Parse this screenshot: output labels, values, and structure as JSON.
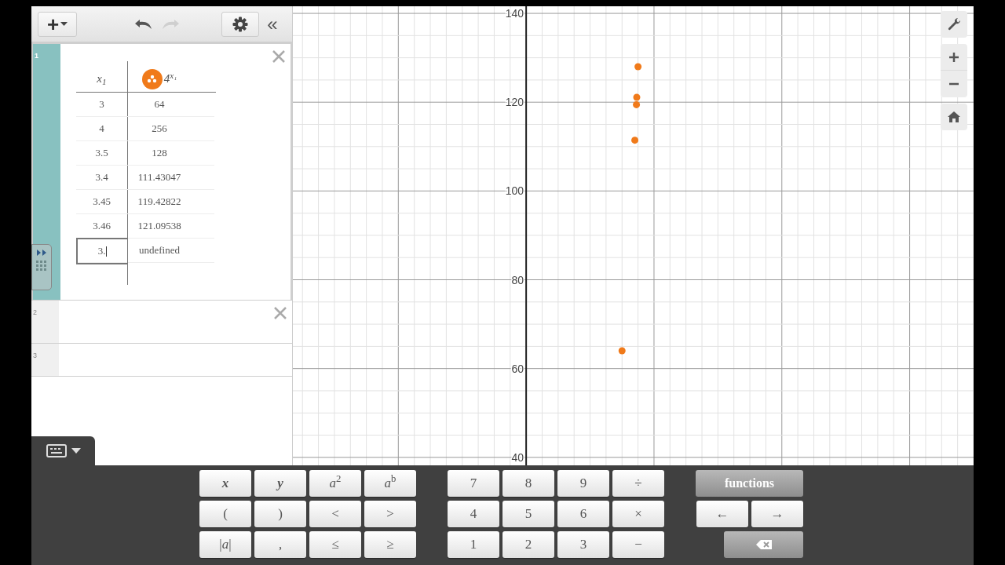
{
  "toolbar": {
    "add_label": "+",
    "undo": {
      "disabled": false
    },
    "redo": {
      "disabled": true
    },
    "collapse_label": "«"
  },
  "expressions": [
    {
      "index": "1",
      "selected": true,
      "close_button": true,
      "kind": "table",
      "table": {
        "columns": [
          {
            "label": "x$_{1}$",
            "color_icon": false
          },
          {
            "label": "4$^{x₁}$",
            "color_icon": true,
            "color": "#f07a1a"
          }
        ],
        "rows": [
          {
            "cells": [
              "3",
              "64"
            ],
            "focused": false
          },
          {
            "cells": [
              "4",
              "256"
            ],
            "focused": false
          },
          {
            "cells": [
              "3.5",
              "128"
            ],
            "focused": false
          },
          {
            "cells": [
              "3.4",
              "111.43047"
            ],
            "focused": false
          },
          {
            "cells": [
              "3.45",
              "119.42822"
            ],
            "focused": false
          },
          {
            "cells": [
              "3.46",
              "121.09538"
            ],
            "focused": false
          },
          {
            "cells": [
              "3.",
              "undefined"
            ],
            "focused": true
          }
        ]
      }
    },
    {
      "index": "2",
      "selected": false,
      "close_button": true,
      "kind": "empty"
    },
    {
      "index": "3",
      "selected": false,
      "close_button": false,
      "kind": "empty"
    }
  ],
  "graph": {
    "y_axis_labels": [
      "140",
      "120",
      "100",
      "80",
      "60",
      "40"
    ]
  },
  "keypad": {
    "groups": [
      {
        "rows": [
          [
            {
              "label": "*x*",
              "kind": "var"
            },
            {
              "label": "*y*",
              "kind": "var"
            },
            {
              "label": "*a*$^{2}$",
              "kind": "key"
            },
            {
              "label": "*a*$^{b}$",
              "kind": "key"
            }
          ],
          [
            {
              "label": "(",
              "kind": "key"
            },
            {
              "label": ")",
              "kind": "key"
            },
            {
              "label": "<",
              "kind": "key"
            },
            {
              "label": ">",
              "kind": "key"
            }
          ],
          [
            {
              "label": "|*a*|",
              "kind": "key"
            },
            {
              "label": ",",
              "kind": "key"
            },
            {
              "label": "≤",
              "kind": "key"
            },
            {
              "label": "≥",
              "kind": "key"
            }
          ]
        ]
      },
      {
        "rows": [
          [
            {
              "label": "7",
              "kind": "key"
            },
            {
              "label": "8",
              "kind": "key"
            },
            {
              "label": "9",
              "kind": "key"
            },
            {
              "label": "÷",
              "kind": "key"
            }
          ],
          [
            {
              "label": "4",
              "kind": "key"
            },
            {
              "label": "5",
              "kind": "key"
            },
            {
              "label": "6",
              "kind": "key"
            },
            {
              "label": "×",
              "kind": "key"
            }
          ],
          [
            {
              "label": "1",
              "kind": "key"
            },
            {
              "label": "2",
              "kind": "key"
            },
            {
              "label": "3",
              "kind": "key"
            },
            {
              "label": "−",
              "kind": "key"
            }
          ]
        ]
      },
      {
        "rows": [
          [
            {
              "label": "functions",
              "kind": "wide"
            }
          ],
          [
            {
              "label": "←",
              "kind": "key"
            },
            {
              "label": "→",
              "kind": "key"
            }
          ],
          [
            {
              "kind": "backspace"
            }
          ]
        ]
      }
    ]
  }
}
